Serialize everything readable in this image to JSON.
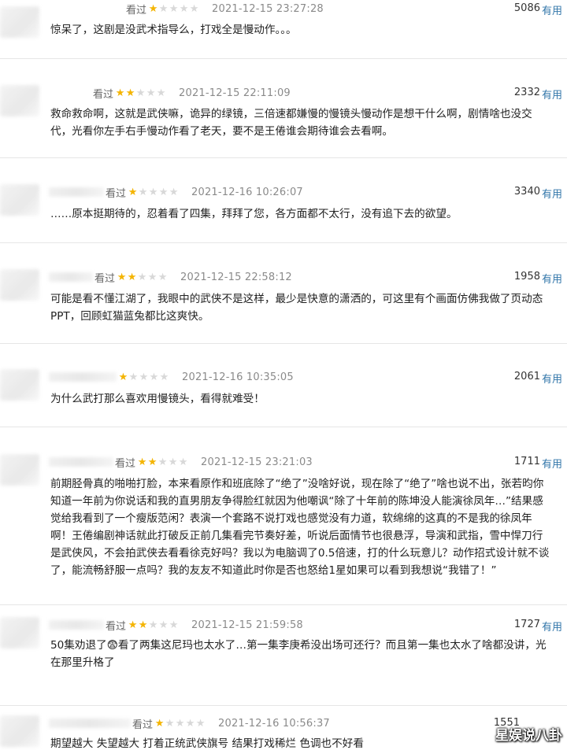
{
  "seen_label": "看过",
  "useful_label": "有用",
  "star_icon": "star-icon",
  "colors": {
    "star_on": "#f4b400",
    "star_off": "#d8d8d8",
    "link": "#3377aa"
  },
  "reviews": [
    {
      "rating": 1,
      "time": "2021-12-15 23:27:28",
      "votes": "5086",
      "text": "惊呆了，这剧是没武术指导么，打戏全是慢动作。。。"
    },
    {
      "rating": 2,
      "time": "2021-12-15 22:11:09",
      "votes": "2332",
      "text": "救命救命啊，这就是武侠嘛，诡异的绿镜，三倍速都嫌慢的慢镜头慢动作是想干什么啊，剧情啥也没交代，光看你左手右手慢动作看了老天，要不是王倦谁会期待谁会去看啊。"
    },
    {
      "rating": 1,
      "time": "2021-12-16 10:26:07",
      "votes": "3340",
      "text": "……原本挺期待的，忍着看了四集，拜拜了您，各方面都不太行，没有追下去的欲望。"
    },
    {
      "rating": 2,
      "time": "2021-12-15 22:58:12",
      "votes": "1958",
      "text": "可能是看不懂江湖了，我眼中的武侠不是这样，最少是快意的潇洒的，可这里有个画面仿佛我做了页动态PPT，回顾虹猫蓝兔都比这爽快。"
    },
    {
      "rating": 1,
      "time": "2021-12-16 10:35:05",
      "votes": "2061",
      "text": "为什么武打那么喜欢用慢镜头，看得就难受！"
    },
    {
      "rating": 2,
      "time": "2021-12-15 23:21:03",
      "votes": "1711",
      "text": "前期胫骨真的啪啪打脸，本来看原作和班底除了“绝了”没啥好说，现在除了“绝了”啥也说不出，张若昀你知道一年前为你说话和我的直男朋友争得脸红就因为他嘲讽“除了十年前的陈坤没人能演徐凤年…”结果感觉给我看到了一个瘦版范闲？表演一个套路不说打戏也感觉没有力道，软绵绵的这真的不是我的徐凤年啊！王倦编剧神话就此打破反正前几集看完节奏好差，听说后面情节也很悬浮，导演和武指，雪中悍刀行是武侠风，不会拍武侠去看看徐克好吗？我以为电脑调了0.5倍速，打的什么玩意儿？动作招式设计就不谈了，能流畅舒服一点吗？我的友友不知道此时你是否也怒给1星如果可以看到我想说“我错了！”"
    },
    {
      "rating": 2,
      "time": "2021-12-15 21:59:58",
      "votes": "1727",
      "text": "50集劝退了😨看了两集这尼玛也太水了…第一集李庚希没出场可还行？而且第一集也太水了啥都没讲，光在那里升格了"
    },
    {
      "rating": 1,
      "time": "2021-12-16 10:56:37",
      "votes": "1551",
      "text": "期望越大 失望越大 打着正统武侠旗号 结果打戏稀烂 色调也不好看"
    }
  ],
  "watermark": "星娱说八卦"
}
